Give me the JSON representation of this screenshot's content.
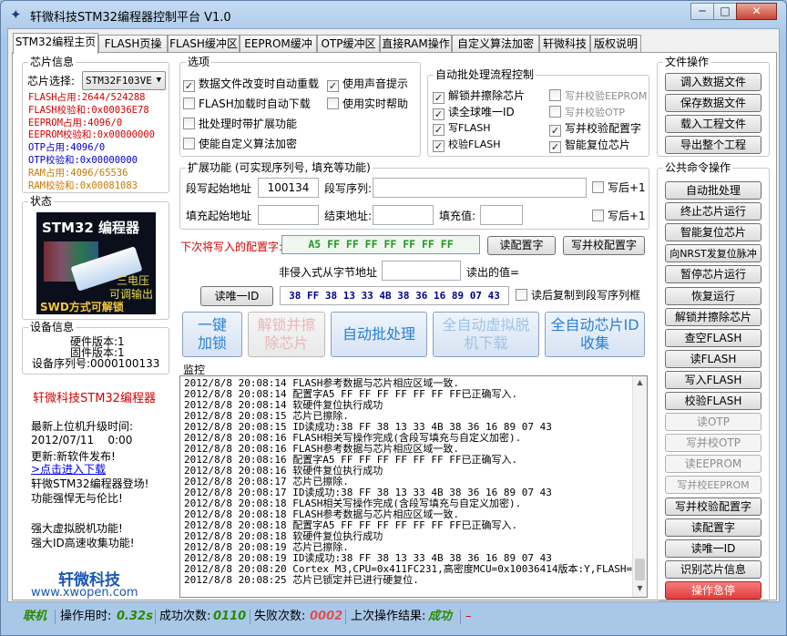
{
  "window": {
    "title": "轩微科技STM32编程器控制平台 V1.0",
    "minimize": "─",
    "maximize": "□",
    "close": "✕",
    "icon": "app-icon"
  },
  "tabs": [
    "STM32编程主页",
    "FLASH页操作",
    "FLASH缓冲区",
    "EEPROM缓冲区",
    "OTP缓冲区",
    "直接RAM操作",
    "自定义算法加密",
    "轩微科技",
    "版权说明"
  ],
  "chip": {
    "title": "芯片信息",
    "select_label": "芯片选择:",
    "selected": "STM32F103VE",
    "lines": [
      {
        "text": "FLASH占用:2644/524288",
        "color": "#d40000"
      },
      {
        "text": "FLASH校验和:0x00036E78",
        "color": "#d40000"
      },
      {
        "text": "EEPROM占用:4096/0",
        "color": "#d40000"
      },
      {
        "text": "EEPROM校验和:0x00000000",
        "color": "#d40000"
      },
      {
        "text": "OTP占用:4096/0",
        "color": "#0000cc"
      },
      {
        "text": "OTP校验和:0x00000000",
        "color": "#0000cc"
      },
      {
        "text": "RAM占用:4096/65536",
        "color": "#c87800"
      },
      {
        "text": "RAM校验和:0x00081083",
        "color": "#c87800"
      }
    ]
  },
  "state": {
    "title": "状态",
    "img_title": "STM32 编程器",
    "img_side": "三电压",
    "img_side2": "可调输出",
    "img_bottom": "SWD方式可解锁"
  },
  "device": {
    "title": "设备信息",
    "hw": "硬件版本:1",
    "fw": "固件版本:1",
    "serial": "设备序列号:0000100133"
  },
  "promo": {
    "heading": "轩微科技STM32编程器",
    "update_label": "最新上位机升级时间:",
    "update_time": "2012/07/11    0:00",
    "update_news": "更新:新软件发布!",
    "link": ">点击进入下载",
    "line1": "轩微STM32编程器登场!",
    "line2": "功能强悍无与伦比!",
    "line3": "强大虚拟脱机功能!",
    "line4": "强大ID高速收集功能!",
    "brand": "轩微科技",
    "url": "www.xwopen.com"
  },
  "options": {
    "title": "选项",
    "items": [
      {
        "label": "数据文件改变时自动重载",
        "checked": true
      },
      {
        "label": "使用声音提示",
        "checked": true
      },
      {
        "label": "FLASH加载时自动下载",
        "checked": false
      },
      {
        "label": "使用实时帮助",
        "checked": false
      },
      {
        "label": "批处理时带扩展功能",
        "checked": false
      },
      {
        "label": "使能自定义算法加密",
        "checked": false
      }
    ]
  },
  "batch": {
    "title": "自动批处理流程控制",
    "items": [
      {
        "label": "解锁并擦除芯片",
        "checked": true,
        "enabled": true
      },
      {
        "label": "写并校验EEPROM",
        "checked": false,
        "enabled": false
      },
      {
        "label": "读全球唯一ID",
        "checked": true,
        "enabled": true
      },
      {
        "label": "写并校验OTP",
        "checked": false,
        "enabled": false
      },
      {
        "label": "写FLASH",
        "checked": true,
        "enabled": true
      },
      {
        "label": "写并校验配置字",
        "checked": true,
        "enabled": true
      },
      {
        "label": "校验FLASH",
        "checked": true,
        "enabled": true
      },
      {
        "label": "智能复位芯片",
        "checked": true,
        "enabled": true
      }
    ]
  },
  "ext": {
    "title": "扩展功能 (可实现序列号, 填充等功能)",
    "seg_start_label": "段写起始地址",
    "seg_start_value": "100134",
    "seg_seq_label": "段写序列:",
    "seg_seq_value": "",
    "write_plus1": "写后+1",
    "fill_start_label": "填充起始地址",
    "fill_start_value": "",
    "end_label": "结束地址:",
    "end_value": "",
    "fill_val_label": "填充值:",
    "fill_val_value": "",
    "write_plus1_b": "写后+1"
  },
  "config": {
    "next_label": "下次将写入的配置字:",
    "value": "A5 FF FF FF FF FF FF FF",
    "read_btn": "读配置字",
    "write_btn": "写并校配置字",
    "nonintrusive_label": "非侵入式从字节地址",
    "addr_value": "",
    "read_value_label": "读出的值=",
    "read_id_btn": "读唯一ID",
    "uid": "38 FF 38 13 33 4B 38 36 16 89 07 43",
    "copy_label": "读后复制到段写序列框"
  },
  "big_buttons": [
    {
      "label": "一键\n加锁",
      "color": "#2a80d6",
      "state": "normal"
    },
    {
      "label": "解锁并擦\n除芯片",
      "color": "#e8b7b7",
      "state": "disabled"
    },
    {
      "label": "自动批处理",
      "color": "#2a80d6",
      "state": "normal"
    },
    {
      "label": "全自动虚拟脱\n机下载",
      "color": "#9fc3e8",
      "state": "normal"
    },
    {
      "label": "全自动芯片ID\n收集",
      "color": "#2a80d6",
      "state": "normal"
    }
  ],
  "monitor": {
    "title": "监控",
    "lines": [
      "2012/8/8 20:08:14 FLASH参考数据与芯片相应区域一致.",
      "2012/8/8 20:08:14 配置字A5 FF FF FF FF FF FF FF已正确写入.",
      "2012/8/8 20:08:14 软硬件复位执行成功",
      "2012/8/8 20:08:15 芯片已擦除.",
      "2012/8/8 20:08:15 ID读成功:38 FF 38 13 33 4B 38 36 16 89 07 43",
      "2012/8/8 20:08:16 FLASH相关写操作完成(含段写填充与自定义加密).",
      "2012/8/8 20:08:16 FLASH参考数据与芯片相应区域一致.",
      "2012/8/8 20:08:16 配置字A5 FF FF FF FF FF FF FF已正确写入.",
      "2012/8/8 20:08:16 软硬件复位执行成功",
      "2012/8/8 20:08:17 芯片已擦除.",
      "2012/8/8 20:08:17 ID读成功:38 FF 38 13 33 4B 38 36 16 89 07 43",
      "2012/8/8 20:08:18 FLASH相关写操作完成(含段写填充与自定义加密).",
      "2012/8/8 20:08:18 FLASH参考数据与芯片相应区域一致.",
      "2012/8/8 20:08:18 配置字A5 FF FF FF FF FF FF FF已正确写入.",
      "2012/8/8 20:08:18 软硬件复位执行成功",
      "2012/8/8 20:08:19 芯片已擦除.",
      "2012/8/8 20:08:19 ID读成功:38 FF 38 13 33 4B 38 36 16 89 07 43",
      "2012/8/8 20:08:20 Cortex_M3,CPU=0x411FC231,高密度MCU=0x10036414版本:Y,FLASH=512K",
      "2012/8/8 20:08:25 芯片已锁定并已进行硬复位."
    ]
  },
  "file_ops": {
    "title": "文件操作",
    "buttons": [
      "调入数据文件",
      "保存数据文件",
      "载入工程文件",
      "导出整个工程"
    ]
  },
  "common": {
    "title": "公共命令操作",
    "buttons": [
      {
        "label": "自动批处理",
        "state": "normal"
      },
      {
        "label": "终止芯片运行",
        "state": "normal"
      },
      {
        "label": "智能复位芯片",
        "state": "normal"
      },
      {
        "label": "向NRST发复位脉冲",
        "state": "normal"
      },
      {
        "label": "暂停芯片运行",
        "state": "normal"
      },
      {
        "label": "恢复运行",
        "state": "normal"
      },
      {
        "label": "解锁并擦除芯片",
        "state": "normal"
      },
      {
        "label": "查空FLASH",
        "state": "normal"
      },
      {
        "label": "读FLASH",
        "state": "normal"
      },
      {
        "label": "写入FLASH",
        "state": "normal"
      },
      {
        "label": "校验FLASH",
        "state": "normal"
      },
      {
        "label": "读OTP",
        "state": "disabled"
      },
      {
        "label": "写并校OTP",
        "state": "disabled"
      },
      {
        "label": "读EEPROM",
        "state": "disabled"
      },
      {
        "label": "写并校EEPROM",
        "state": "disabled"
      },
      {
        "label": "写并校验配置字",
        "state": "normal"
      },
      {
        "label": "读配置字",
        "state": "normal"
      },
      {
        "label": "读唯一ID",
        "state": "normal"
      },
      {
        "label": "识别芯片信息",
        "state": "normal"
      },
      {
        "label": "操作急停",
        "state": "danger"
      }
    ]
  },
  "status": {
    "link": "联机",
    "op_time_label": "操作用时:",
    "op_time": "0.32s",
    "success_label": "成功次数:",
    "success": "0110",
    "fail_label": "失败次数:",
    "fail": "0002",
    "last_label": "上次操作结果:",
    "last": "成功",
    "tail": "–",
    "colors": {
      "ok": "#2a8a00",
      "fail": "#e05050"
    }
  }
}
